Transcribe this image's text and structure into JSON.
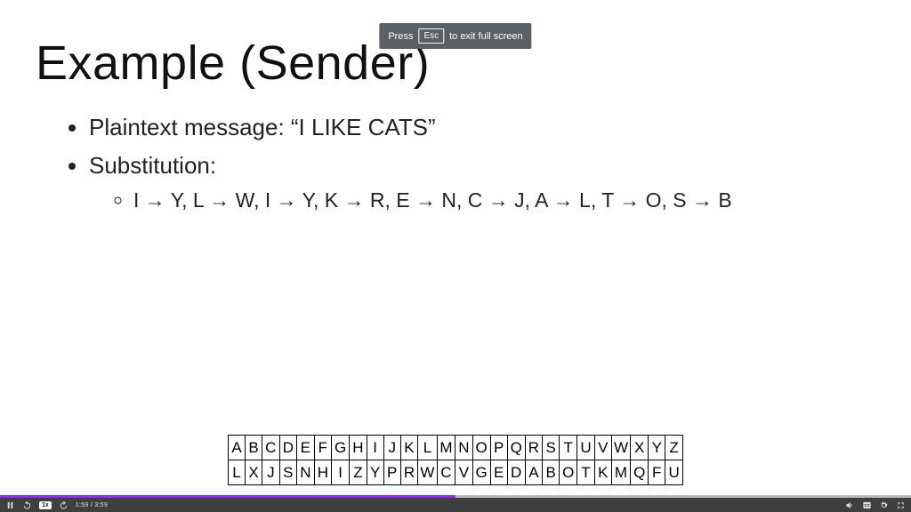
{
  "banner": {
    "pre": "Press",
    "key": "Esc",
    "post": "to exit full screen"
  },
  "slide": {
    "title": "Example (Sender)",
    "bullet1": "Plaintext message: “I LIKE CATS”",
    "bullet2": "Substitution:",
    "subbullet": "I → Y, L → W, I → Y, K → R, E → N, C → J, A → L, T → O, S → B"
  },
  "table": {
    "row1": [
      "A",
      "B",
      "C",
      "D",
      "E",
      "F",
      "G",
      "H",
      "I",
      "J",
      "K",
      "L",
      "M",
      "N",
      "O",
      "P",
      "Q",
      "R",
      "S",
      "T",
      "U",
      "V",
      "W",
      "X",
      "Y",
      "Z"
    ],
    "row2": [
      "L",
      "X",
      "J",
      "S",
      "N",
      "H",
      "I",
      "Z",
      "Y",
      "P",
      "R",
      "W",
      "C",
      "V",
      "G",
      "E",
      "D",
      "A",
      "B",
      "O",
      "T",
      "K",
      "M",
      "Q",
      "F",
      "U"
    ]
  },
  "player": {
    "speed": "1x",
    "time": "1:59 / 3:59",
    "progress_pct": 50
  }
}
